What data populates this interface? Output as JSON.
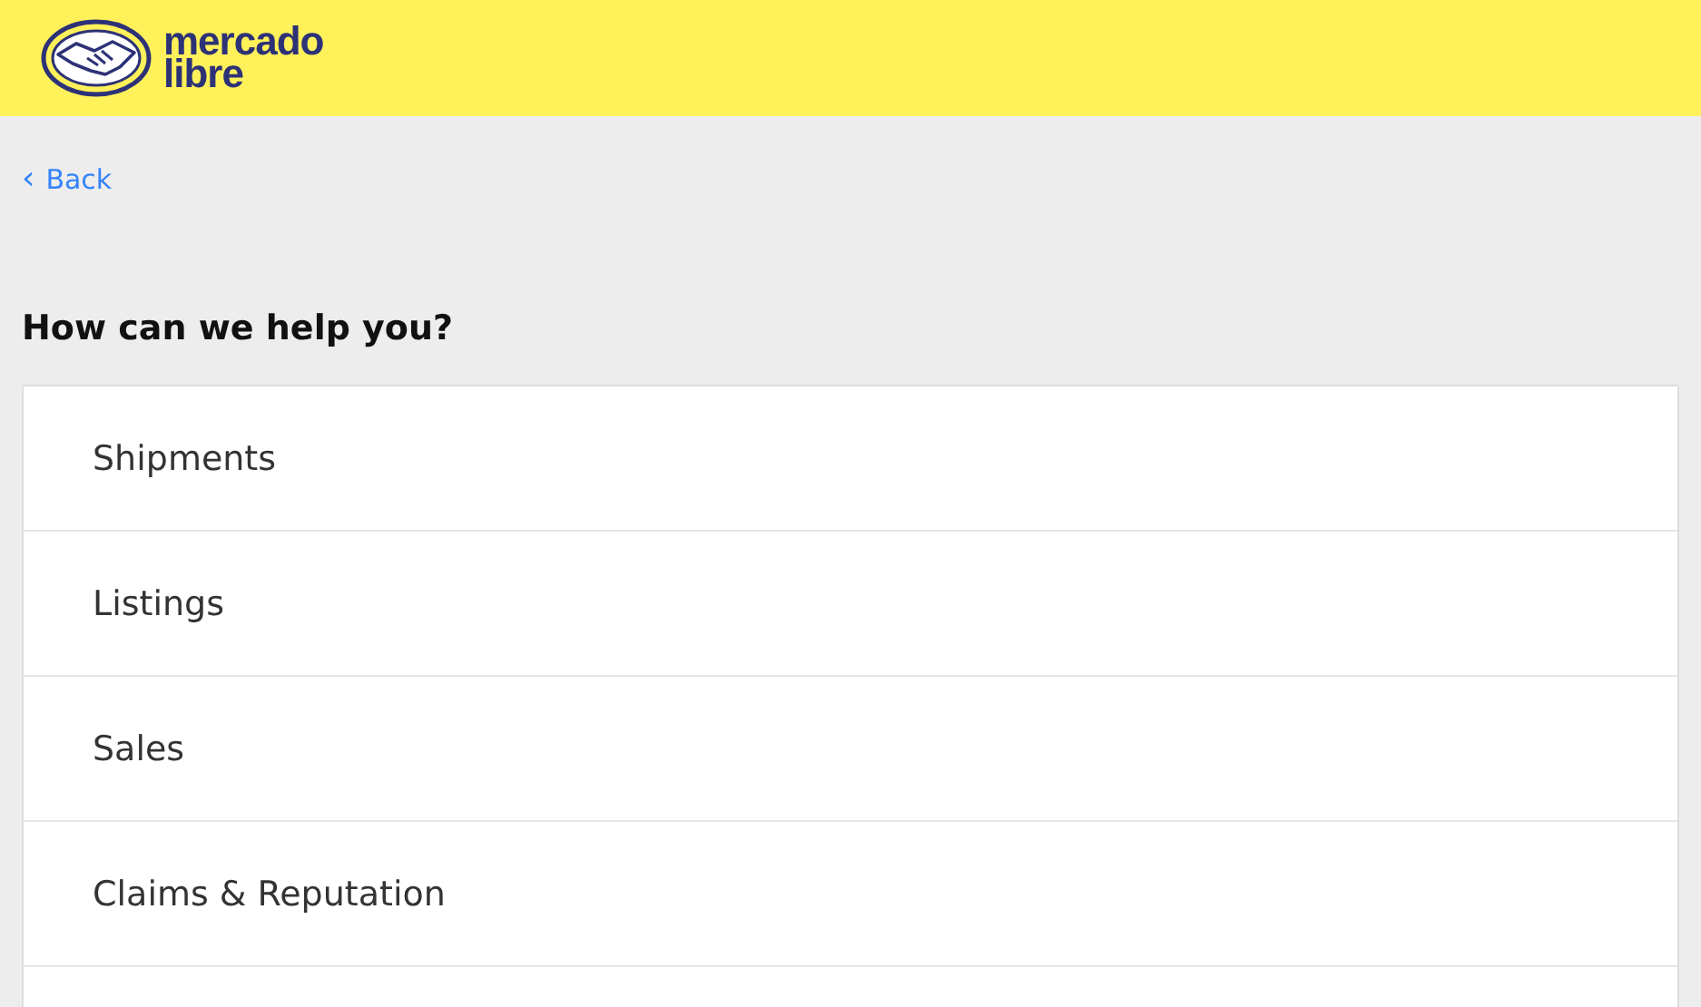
{
  "header": {
    "logo_lines": [
      "mercado",
      "libre"
    ]
  },
  "back_link": {
    "icon": "‹",
    "label": "Back"
  },
  "title": "How can we help you?",
  "topics": [
    {
      "label": "Shipments"
    },
    {
      "label": "Listings"
    },
    {
      "label": "Sales"
    },
    {
      "label": "Claims & Reputation"
    }
  ]
}
